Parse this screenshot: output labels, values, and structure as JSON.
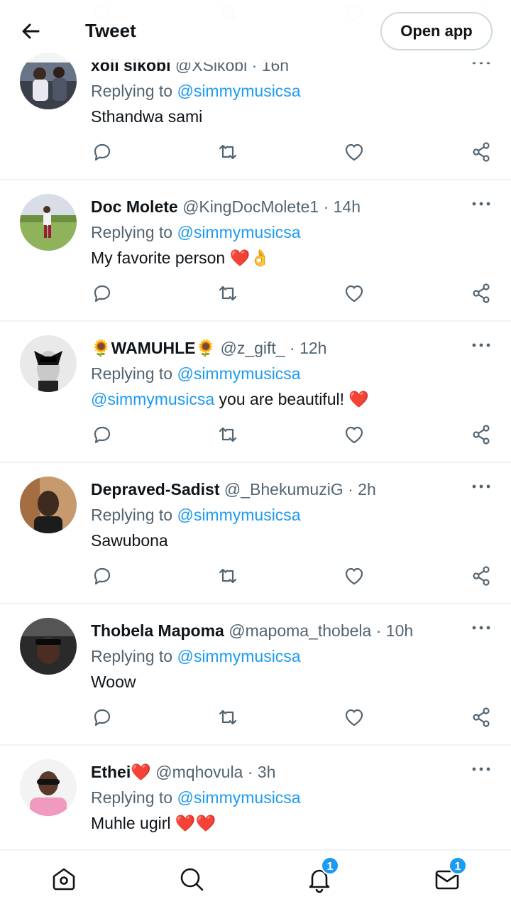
{
  "header": {
    "title": "Tweet",
    "open_app": "Open app"
  },
  "tweets": [
    {
      "name": "xoli sikobi",
      "handle": "@XSikobi",
      "time": "16h",
      "replying_label": "Replying to",
      "replying_to": "@simmymusicsa",
      "text": "Sthandwa sami",
      "text_suffix": ""
    },
    {
      "name": "Doc Molete",
      "handle": "@KingDocMolete1",
      "time": "14h",
      "replying_label": "Replying to",
      "replying_to": "@simmymusicsa",
      "text": "My favorite person",
      "text_suffix": "❤️👌"
    },
    {
      "name": "🌻WAMUHLE🌻",
      "handle": "@z_gift_",
      "time": "12h",
      "replying_label": "Replying to",
      "replying_to": "@simmymusicsa",
      "text_mention": "@simmymusicsa",
      "text": " you are beautiful!",
      "text_suffix": "❤️"
    },
    {
      "name": "Depraved-Sadist",
      "handle": "@_BhekumuziG",
      "time": "2h",
      "replying_label": "Replying to",
      "replying_to": "@simmymusicsa",
      "text": "Sawubona",
      "text_suffix": ""
    },
    {
      "name": "Thobela Mapoma",
      "handle": "@mapoma_thobela",
      "time": "10h",
      "replying_label": "Replying to",
      "replying_to": "@simmymusicsa",
      "text": "Woow",
      "text_suffix": ""
    },
    {
      "name": "Ethei❤️",
      "handle": "@mqhovula",
      "time": "3h",
      "replying_label": "Replying to",
      "replying_to": "@simmymusicsa",
      "text": "Muhle ugirl",
      "text_suffix": "❤️❤️"
    }
  ],
  "dot": "·",
  "tabbar": {
    "notifications_badge": "1",
    "messages_badge": "1"
  },
  "icons": [
    "back-arrow-icon",
    "more-icon",
    "reply-icon",
    "retweet-icon",
    "like-icon",
    "share-icon",
    "home-icon",
    "search-icon",
    "bell-icon",
    "mail-icon"
  ],
  "colors": {
    "accent": "#1d9bf0",
    "text": "#0f1419",
    "secondary": "#536471",
    "divider": "#eff3f4",
    "heart": "#e0245e"
  }
}
